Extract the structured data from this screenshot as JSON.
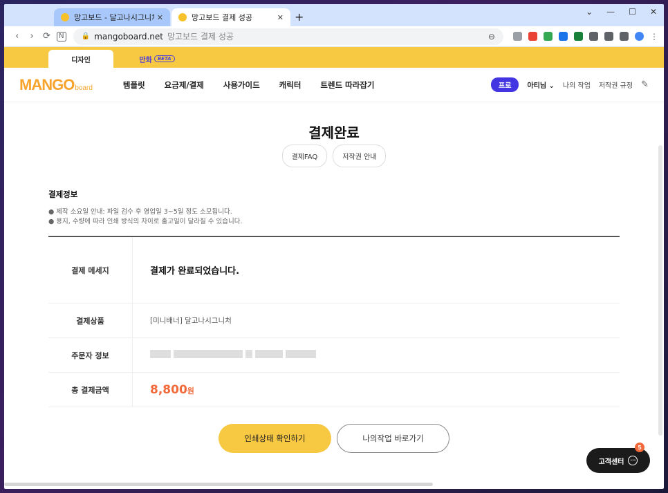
{
  "browser": {
    "tabs": [
      {
        "title": "망고보드 - 달고나시그니처",
        "active": false
      },
      {
        "title": "망고보드 결제 성공",
        "active": true
      }
    ],
    "new_tab": "+",
    "window_controls": [
      "⌄",
      "—",
      "☐",
      "✕"
    ],
    "url_domain": "mangoboard.net",
    "url_title": "망고보드 결제 성공",
    "nav": {
      "back": "‹",
      "forward": "›",
      "reload": "⟳",
      "home": "N"
    }
  },
  "site_tabs": {
    "design": "디자인",
    "comic": "만화",
    "beta": "BETA"
  },
  "header": {
    "logo_main": "MANGO",
    "logo_sub": "board",
    "nav": [
      "템플릿",
      "요금제/결제",
      "사용가이드",
      "캐릭터",
      "트렌드 따라잡기"
    ],
    "pro_badge": "프로",
    "user": "아티님",
    "user_caret": "⌄",
    "my_work": "나의 작업",
    "copyright_rules": "저작권 규정"
  },
  "page": {
    "title": "결제완료",
    "pill_faq": "결제FAQ",
    "pill_copyright": "저작권 안내",
    "info_title": "결제정보",
    "notes": [
      "● 제작 소요일 안내: 파일 검수 후 영업일 3~5일 정도 소모됩니다.",
      "● 용지, 수량에 따라 인쇄 방식의 차이로 출고일이 달라질 수 있습니다."
    ],
    "rows": [
      {
        "label": "결제 메세지",
        "value": "결제가 완료되었습니다."
      },
      {
        "label": "결제상품",
        "value": "[미니배너] 달고나시그니처"
      },
      {
        "label": "주문자 정보",
        "value": ""
      },
      {
        "label": "총 결제금액",
        "amount": "8,800",
        "unit": "원"
      }
    ],
    "btn_print_status": "인쇄상태 확인하기",
    "btn_my_work": "나의작업 바로가기"
  },
  "support": {
    "label": "고객센터",
    "badge": "5"
  },
  "colors": {
    "brand_yellow": "#f7c842",
    "accent_purple": "#4335e2",
    "price_orange": "#f26a3c"
  }
}
